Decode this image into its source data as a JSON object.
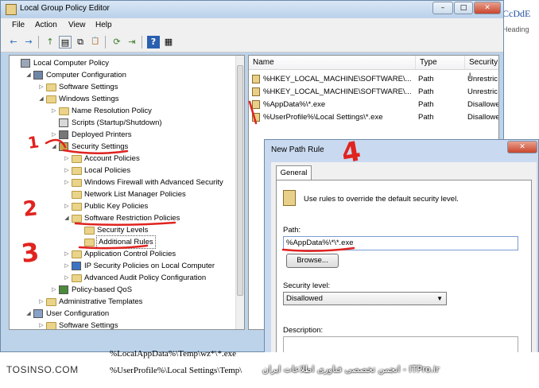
{
  "window": {
    "title": "Local Group Policy Editor",
    "minimize": "–",
    "maximize": "□",
    "close": "✕"
  },
  "background_doc": {
    "right_text": "CcDdE",
    "right_heading": "Heading",
    "bottom_lines": [
      "%LocalAppData%\\Temp\\wz*\\*.exe",
      "%UserProfile%\\Local Settings\\Temp\\"
    ]
  },
  "menu": [
    "File",
    "Action",
    "View",
    "Help"
  ],
  "toolbar": {
    "back": "←",
    "forward": "→",
    "up": "↑",
    "show_hide": "▤",
    "copy": "⧉",
    "paste": "📋",
    "refresh": "⟳",
    "export": "⇥",
    "help": "?",
    "properties": "▦"
  },
  "tree": [
    {
      "label": "Local Computer Policy",
      "level": 0,
      "exp": "",
      "icon": "policy-icon"
    },
    {
      "label": "Computer Configuration",
      "level": 1,
      "exp": "◢",
      "icon": "computer-icon"
    },
    {
      "label": "Software Settings",
      "level": 2,
      "exp": "▷",
      "icon": "folder"
    },
    {
      "label": "Windows Settings",
      "level": 2,
      "exp": "◢",
      "icon": "folder"
    },
    {
      "label": "Name Resolution Policy",
      "level": 3,
      "exp": "▷",
      "icon": "folder"
    },
    {
      "label": "Scripts (Startup/Shutdown)",
      "level": 3,
      "exp": "",
      "icon": "script-icon"
    },
    {
      "label": "Deployed Printers",
      "level": 3,
      "exp": "▷",
      "icon": "printer-icon"
    },
    {
      "label": "Security Settings",
      "level": 3,
      "exp": "◢",
      "icon": "security-icon"
    },
    {
      "label": "Account Policies",
      "level": 4,
      "exp": "▷",
      "icon": "folder"
    },
    {
      "label": "Local Policies",
      "level": 4,
      "exp": "▷",
      "icon": "folder"
    },
    {
      "label": "Windows Firewall with Advanced Security",
      "level": 4,
      "exp": "▷",
      "icon": "folder"
    },
    {
      "label": "Network List Manager Policies",
      "level": 4,
      "exp": "",
      "icon": "folder"
    },
    {
      "label": "Public Key Policies",
      "level": 4,
      "exp": "▷",
      "icon": "folder"
    },
    {
      "label": "Software Restriction Policies",
      "level": 4,
      "exp": "◢",
      "icon": "folder"
    },
    {
      "label": "Security Levels",
      "level": 5,
      "exp": "",
      "icon": "folder"
    },
    {
      "label": "Additional Rules",
      "level": 5,
      "exp": "",
      "icon": "folder"
    },
    {
      "label": "Application Control Policies",
      "level": 4,
      "exp": "▷",
      "icon": "folder"
    },
    {
      "label": "IP Security Policies on Local Computer",
      "level": 4,
      "exp": "▷",
      "icon": "ipsec-icon"
    },
    {
      "label": "Advanced Audit Policy Configuration",
      "level": 4,
      "exp": "▷",
      "icon": "folder"
    },
    {
      "label": "Policy-based QoS",
      "level": 3,
      "exp": "▷",
      "icon": "chart-icon"
    },
    {
      "label": "Administrative Templates",
      "level": 2,
      "exp": "▷",
      "icon": "folder"
    },
    {
      "label": "User Configuration",
      "level": 1,
      "exp": "◢",
      "icon": "user-icon"
    },
    {
      "label": "Software Settings",
      "level": 2,
      "exp": "▷",
      "icon": "folder"
    }
  ],
  "list": {
    "columns": [
      "Name",
      "Type",
      "Security l"
    ],
    "rows": [
      {
        "name": "%HKEY_LOCAL_MACHINE\\SOFTWARE\\...",
        "type": "Path",
        "security": "Unrestric"
      },
      {
        "name": "%HKEY_LOCAL_MACHINE\\SOFTWARE\\...",
        "type": "Path",
        "security": "Unrestric"
      },
      {
        "name": "%AppData%\\*.exe",
        "type": "Path",
        "security": "Disallowe"
      },
      {
        "name": "%UserProfile%\\Local Settings\\*.exe",
        "type": "Path",
        "security": "Disallowe"
      }
    ]
  },
  "dialog": {
    "title": "New Path Rule",
    "tab": "General",
    "info": "Use rules to override the default security level.",
    "path_label": "Path:",
    "path_value": "%AppData%\\*\\*.exe",
    "browse": "Browse...",
    "security_label": "Security level:",
    "security_value": "Disallowed",
    "description_label": "Description:"
  },
  "annotations": [
    "1",
    "2",
    "3",
    "4"
  ],
  "footer": {
    "brand": "TOSINSO.COM",
    "forum": "انجمن تخصصی فناوری اطلاعات ایران - ITPro.ir"
  },
  "colors": {
    "annotation": "#e0231f",
    "selection_folder": "#ead38a"
  }
}
